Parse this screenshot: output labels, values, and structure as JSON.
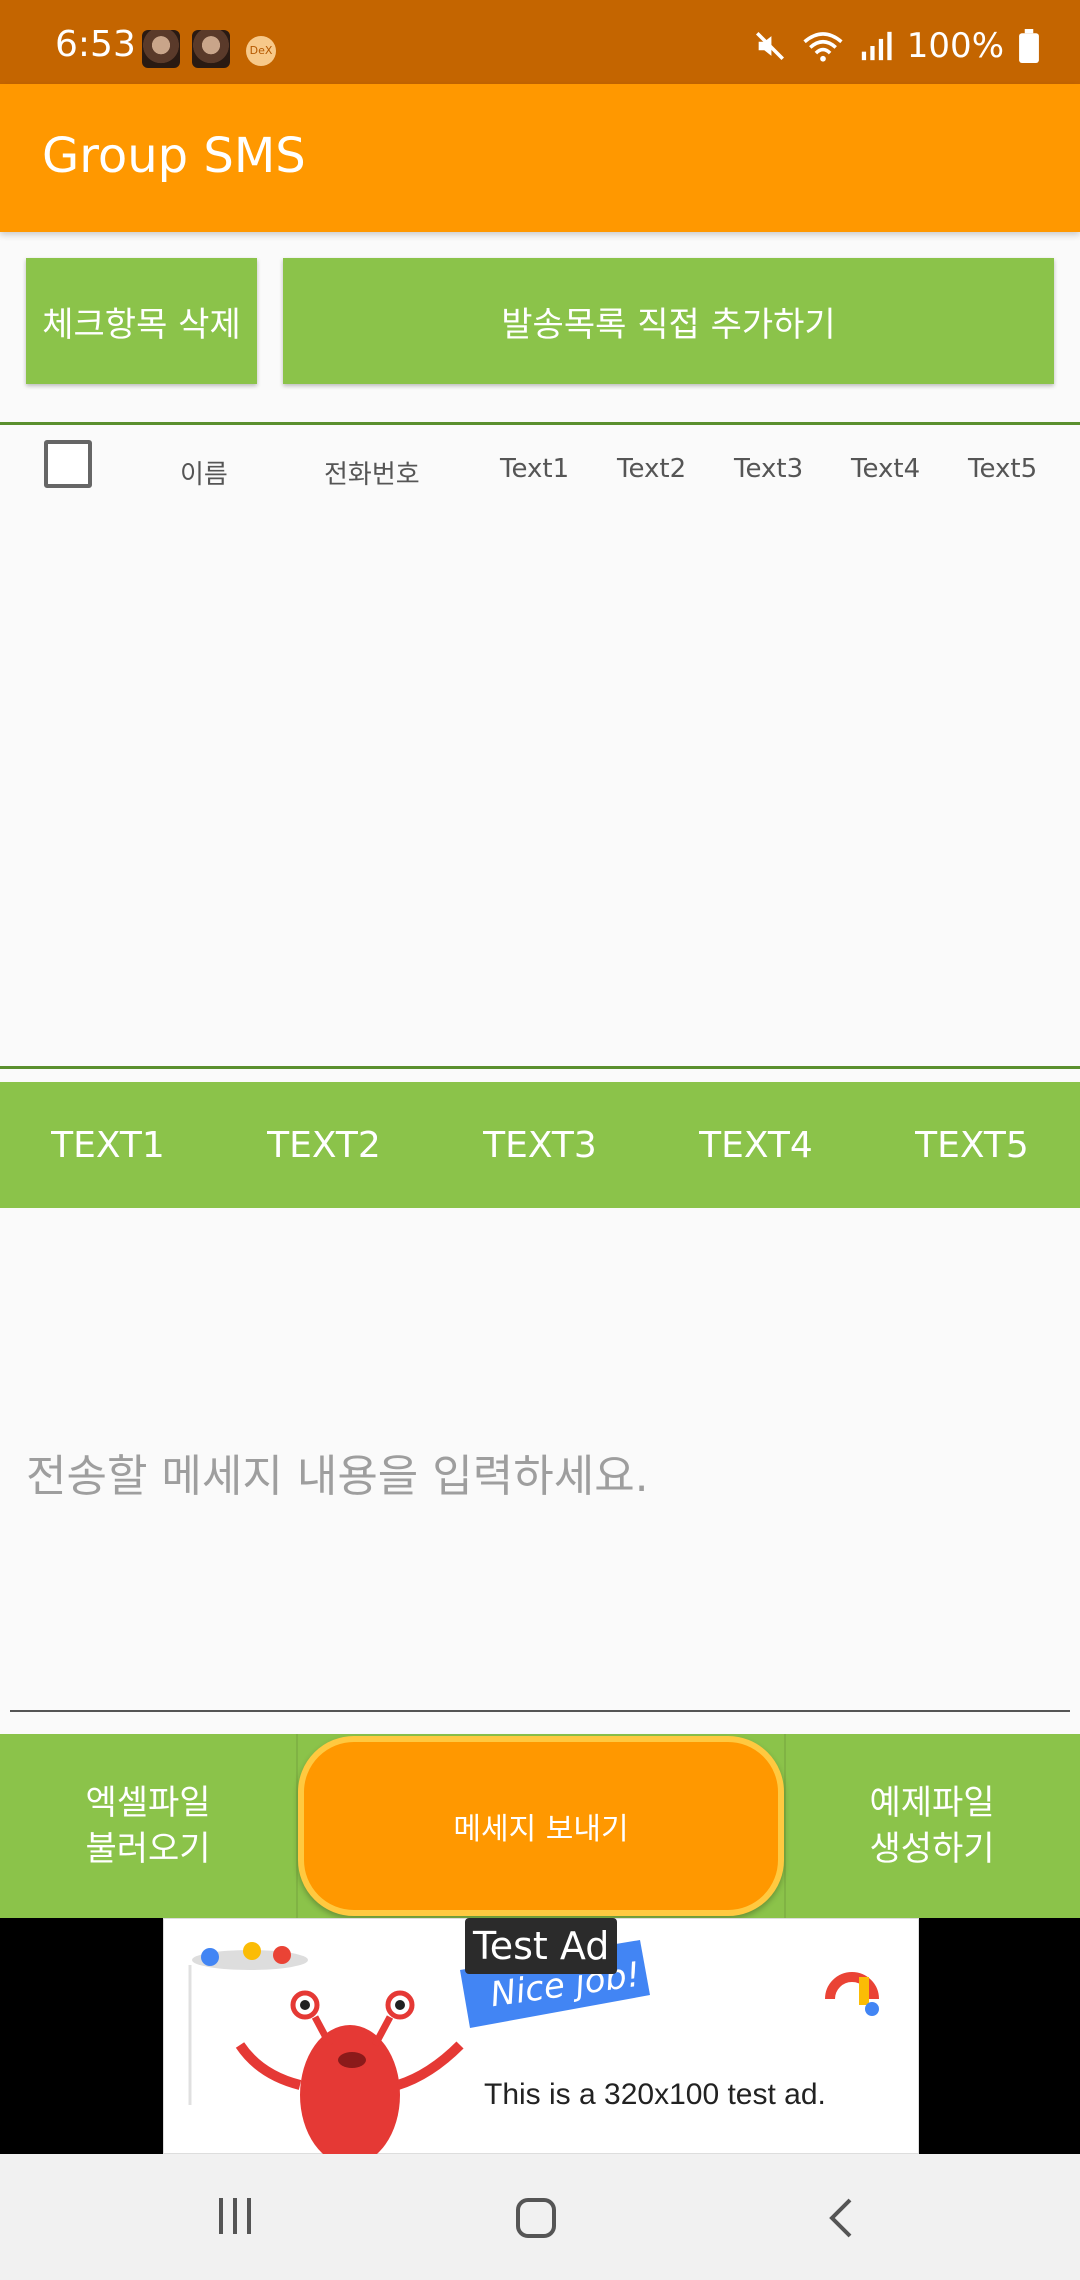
{
  "status_bar": {
    "time": "6:53",
    "dex_badge": "DeX",
    "battery": "100%"
  },
  "app_bar": {
    "title": "Group SMS"
  },
  "actions": {
    "delete_checked": "체크항목 삭제",
    "add_directly": "발송목록 직접 추가하기"
  },
  "list_header": {
    "name": "이름",
    "phone": "전화번호",
    "text1": "Text1",
    "text2": "Text2",
    "text3": "Text3",
    "text4": "Text4",
    "text5": "Text5"
  },
  "tag_bar": [
    "TEXT1",
    "TEXT2",
    "TEXT3",
    "TEXT4",
    "TEXT5"
  ],
  "message": {
    "placeholder": "전송할 메세지 내용을 입력하세요."
  },
  "bottom_bar": {
    "excel_line1": "엑셀파일",
    "excel_line2": "불러오기",
    "send": "메세지 보내기",
    "sample_line1": "예제파일",
    "sample_line2": "생성하기"
  },
  "ad": {
    "label": "Test Ad",
    "banner": "Nice job!",
    "text": "This is a 320x100 test ad."
  },
  "colors": {
    "status_bar": "#C46500",
    "app_bar": "#FF9800",
    "green": "#8BC34A",
    "send_border": "#FFC940"
  }
}
